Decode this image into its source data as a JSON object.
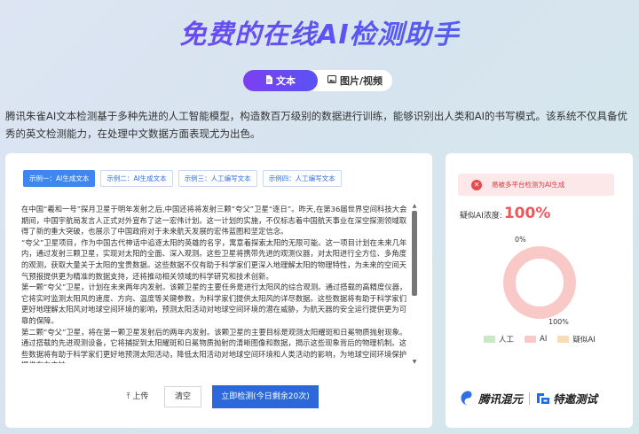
{
  "title": "免费的在线AI检测助手",
  "mode_tabs": [
    {
      "label": "文本",
      "icon": "document-icon",
      "active": true
    },
    {
      "label": "图片/视频",
      "icon": "image-icon",
      "active": false
    }
  ],
  "description": "腾讯朱雀AI文本检测基于多种先进的人工智能模型，构造数百万级别的数据进行训练，能够识别出人类和AI的书写模式。该系统不仅具备优秀的英文检测能力，在处理中文数据方面表现尤为出色。",
  "examples": [
    {
      "label": "示例一：AI生成文本",
      "active": true
    },
    {
      "label": "示例二：AI生成文本",
      "active": false
    },
    {
      "label": "示例三：人工编写文本",
      "active": false
    },
    {
      "label": "示例四：人工编写文本",
      "active": false
    }
  ],
  "text_paragraphs": [
    "在中国“羲和一号”探月卫星于明年发射之后,中国还将将发射三颗“夸父”卫星“逐日”。昨天,在第36届世界空间科技大会期间，中国宇航局发言人正式对外宣布了这一宏伟计划。这一计划的实施，不仅标志着中国航天事业在深空探测领域取得了新的重大突破，也展示了中国政府对于未来航天发展的宏伟蓝图和坚定信念。",
    "“夸父”卫星项目，作为中国古代神话中追逐太阳的英雄的名字，寓意着探索太阳的无限可能。这一项目计划在未来几年内，通过发射三颗卫星，实现对太阳的全面、深入观测。这些卫星将携带先进的观测仪器，对太阳进行全方位、多角度的观测，获取大量关于太阳的宝贵数据。这些数据不仅有助于科学家们更深入地理解太阳的物理特性，为未来的空间天气预报提供更为精准的数据支持，还将推动相关领域的科学研究和技术创新。",
    "第一颗“夸父”卫星，计划在未来两年内发射。该颗卫星的主要任务是进行太阳风的综合观测。通过搭载的高精度仪器，它将实时监测太阳风的速度、方向、温度等关键参数，为科学家们提供太阳风的详尽数据。这些数据将有助于科学家们更好地理解太阳风对地球空间环境的影响，预测太阳活动对地球空间环境的潜在威胁，为航天器的安全运行提供更为可靠的保障。",
    "第二颗“夸父”卫星，将在第一颗卫星发射后的两年内发射。该颗卫星的主要目标是观测太阳耀斑和日冕物质抛射现象。通过搭载的先进观测设备，它将捕捉到太阳耀斑和日冕物质抛射的清晰图像和数据，揭示这些现象背后的物理机制。这些数据将有助于科学家们更好地预测太阳活动，降低太阳活动对地球空间环境和人类活动的影响，为地球空间环境保护提供有力支持。"
  ],
  "actions": {
    "upload_label": "上传",
    "upload_icon": "upload-icon",
    "clear_label": "清空",
    "detect_label": "立即检测(今日剩余20次)"
  },
  "result": {
    "alert_icon": "close-icon",
    "alert_text": "易被多平台检测为AI生成",
    "score_label": "疑似AI浓度:",
    "score_value": "100%"
  },
  "chart_data": {
    "type": "pie",
    "labels": [
      "人工",
      "AI",
      "疑似AI"
    ],
    "values": [
      0,
      100,
      0
    ],
    "colors": [
      "#c9e8c4",
      "#f9c9c7",
      "#f8dcb5"
    ],
    "data_labels": [
      "0%",
      "100%"
    ],
    "legend_position": "bottom"
  },
  "brands": [
    {
      "name": "腾讯混元",
      "icon": "hunyuan-logo-icon"
    },
    {
      "name": "特邀测试",
      "icon": "partner-logo-icon"
    }
  ]
}
